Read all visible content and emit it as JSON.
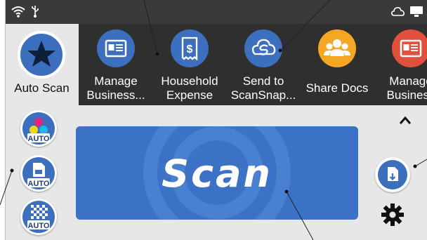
{
  "left_panel": {
    "auto_scan_label": "Auto Scan"
  },
  "tiles": [
    {
      "label": "Manage\nBusiness...",
      "icon": "business-card-icon",
      "color": "#3c6fbe"
    },
    {
      "label": "Household\nExpense",
      "icon": "receipt-icon",
      "color": "#3c6fbe"
    },
    {
      "label": "Send to\nScanSnap...",
      "icon": "cloud-sync-icon",
      "color": "#3c6fbe"
    },
    {
      "label": "Share Docs",
      "icon": "people-icon",
      "color": "#f5a623"
    },
    {
      "label": "Manage\nBusiness",
      "icon": "business-card-icon",
      "color": "#e0503c"
    }
  ],
  "mode_buttons": [
    {
      "badge": "AUTO",
      "icon": "color-mode-icon"
    },
    {
      "badge": "AUTO",
      "icon": "paper-size-icon"
    },
    {
      "badge": "AUTO",
      "icon": "quality-icon"
    }
  ],
  "scan_button": {
    "label": "Scan"
  },
  "colors": {
    "accent": "#3c6fbe",
    "tile_bar": "#2f2f2f",
    "status_bar": "#3a3a3a",
    "share_docs": "#f5a623",
    "manage_red": "#e0503c"
  }
}
